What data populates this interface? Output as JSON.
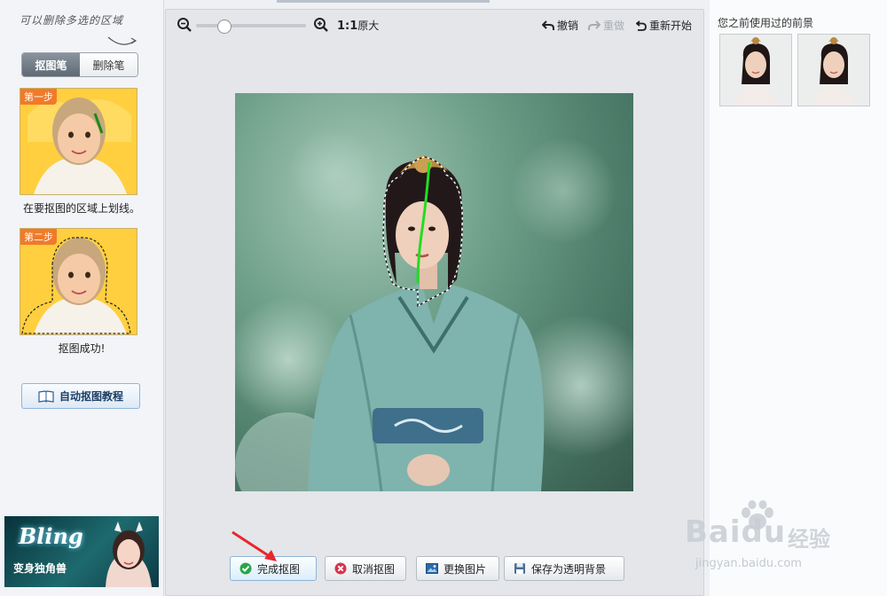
{
  "left": {
    "hint": "可以删除多选的区域",
    "tabs": {
      "cutout_pen": "抠图笔",
      "erase_pen": "删除笔"
    },
    "step1": {
      "badge": "第一步",
      "caption": "在要抠图的区域上划线。"
    },
    "step2": {
      "badge": "第二步",
      "caption": "抠图成功!"
    },
    "tutorial_button": "自动抠图教程",
    "ad": {
      "title": "Bling",
      "subtitle": "变身独角兽"
    }
  },
  "toolbar": {
    "ratio_label": "1:1",
    "original_size": "原大",
    "undo": "撤销",
    "redo": "重做",
    "restart": "重新开始",
    "zoom_level": 0.25
  },
  "bottom": {
    "finish": "完成抠图",
    "cancel": "取消抠图",
    "replace": "更换图片",
    "save_transparent": "保存为透明背景"
  },
  "right": {
    "title": "您之前使用过的前景"
  },
  "watermark": {
    "brand": "Baidu",
    "cn": "经验",
    "url": "jingyan.baidu.com"
  },
  "colors": {
    "accent": "#1e3f66",
    "stroke": "#22dd22",
    "badge": "#f07a2a"
  }
}
